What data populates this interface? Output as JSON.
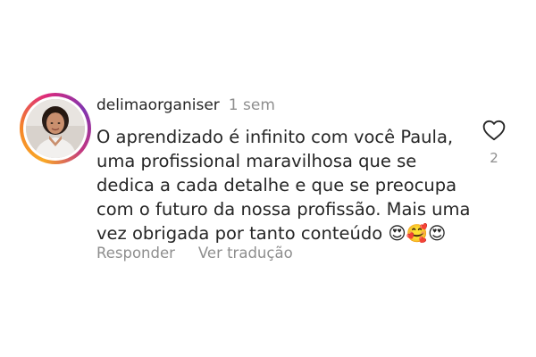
{
  "comment": {
    "username": "delimaorganiser",
    "time": "1 sem",
    "text": "O aprendizado é infinito com você Paula, uma profissional maravilhosa que se dedica a cada detalhe e que se preocupa com o futuro da nossa profissão. Mais uma vez obrigada por tanto conteúdo 😍🥰😍",
    "reply_label": "Responder",
    "translate_label": "Ver tradução",
    "like_icon": "heart-outline-icon",
    "like_count": "2"
  },
  "colors": {
    "text": "#262626",
    "muted": "#8e8e8e",
    "story_ring": [
      "#f9a826",
      "#f58529",
      "#dd2a7b",
      "#8134af"
    ]
  }
}
